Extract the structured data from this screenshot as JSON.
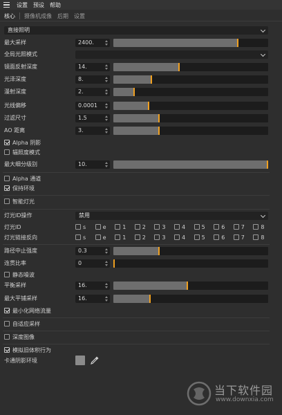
{
  "menubar": {
    "items": [
      "设置",
      "预设",
      "帮助"
    ]
  },
  "tabs": [
    "核心",
    "摄像机成像",
    "后期",
    "设置"
  ],
  "direct_lighting": "直接照明",
  "rows": [
    {
      "label": "最大采样",
      "value": "2400.",
      "fill": 0.81
    },
    {
      "label": "全局光照模式"
    },
    {
      "label": "镜面反射深度",
      "value": "14.",
      "fill": 0.43
    },
    {
      "label": "光泽深度",
      "value": "8.",
      "fill": 0.25
    },
    {
      "label": "漫射深度",
      "value": "2.",
      "fill": 0.14
    },
    {
      "label": "光线偏移",
      "value": "0.0001",
      "fill": 0.23
    },
    {
      "label": "过滤尺寸",
      "value": "1.5",
      "fill": 0.3
    },
    {
      "label": "AO 距离",
      "value": "3.",
      "fill": 0.3
    },
    {
      "label": "最大细分级别",
      "value": "10.",
      "fill": 1.0
    },
    {
      "label": "路径中止强度",
      "value": "0.3",
      "fill": 0.3
    },
    {
      "label": "连贯比率",
      "value": "0",
      "fill": 0.0
    },
    {
      "label": "平衡采样",
      "value": "16.",
      "fill": 0.48
    },
    {
      "label": "最大平铺采样",
      "value": "16.",
      "fill": 0.24
    }
  ],
  "checks": {
    "alpha_shadow": {
      "label": "Alpha 阴影",
      "checked": true
    },
    "irradiance_mode": {
      "label": "辐照度模式",
      "checked": false
    },
    "alpha_channel": {
      "label": "Alpha 通道",
      "checked": false
    },
    "keep_env": {
      "label": "保持环境",
      "checked": true
    },
    "smart_light": {
      "label": "智能灯光",
      "checked": false
    },
    "static_noise": {
      "label": "静态噪波",
      "checked": false
    },
    "min_net_trace": {
      "label": "最小化网络流量",
      "checked": true
    },
    "adaptive": {
      "label": "自适应采样",
      "checked": false
    },
    "depth_image": {
      "label": "深度图像",
      "checked": false
    },
    "legacy_volume": {
      "label": "模拟旧体积行为",
      "checked": true
    }
  },
  "light_id_op": {
    "label": "灯光ID操作",
    "value": "禁用"
  },
  "light_id": {
    "label": "灯光ID",
    "items": [
      "s",
      "e",
      "1",
      "2",
      "3",
      "4",
      "5",
      "6",
      "7",
      "8"
    ]
  },
  "light_link_invert": {
    "label": "灯光链接反向",
    "items": [
      "s",
      "e",
      "1",
      "2",
      "3",
      "4",
      "5",
      "6",
      "7",
      "8"
    ]
  },
  "cartoon_shadow": {
    "label": "卡通阴影环境",
    "color": "#8a8a8a"
  },
  "accent": "#f0a020",
  "watermark": {
    "cn": "当下软件园",
    "url": "www.downxia.com"
  }
}
